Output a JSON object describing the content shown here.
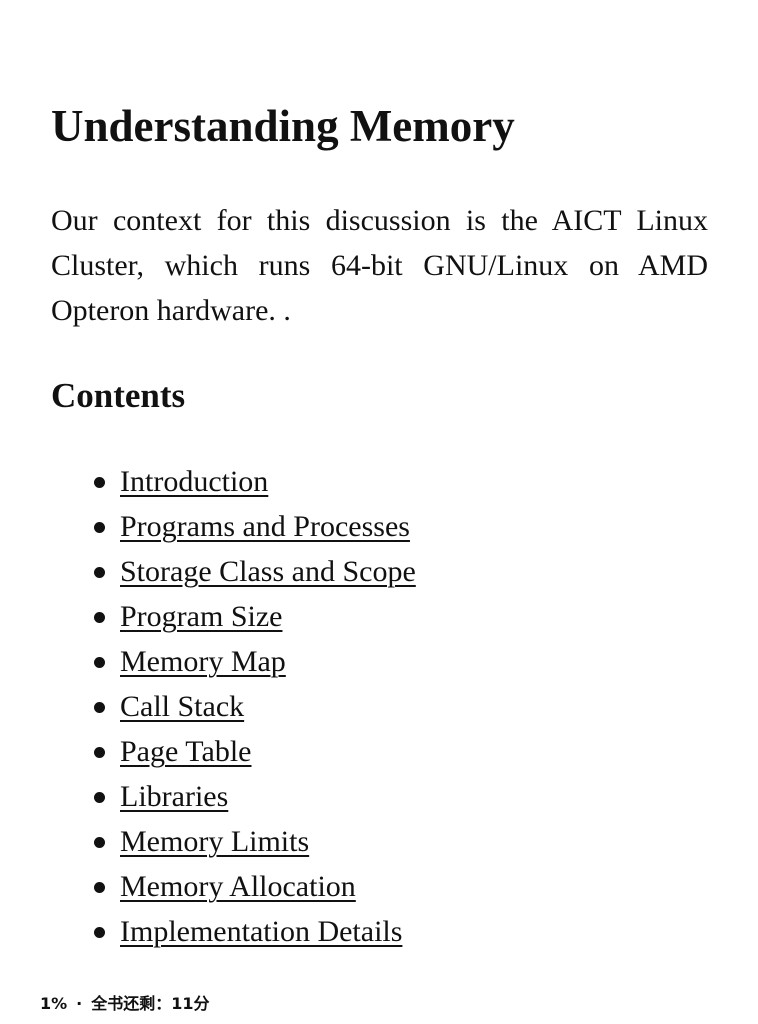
{
  "article": {
    "title": "Understanding Memory",
    "intro": "Our context for this discussion is the AICT Linux Cluster, which runs 64-bit GNU/Linux on AMD Opteron hardware. .",
    "contents_heading": "Contents"
  },
  "toc": {
    "items": [
      {
        "label": "Introduction"
      },
      {
        "label": "Programs and Processes"
      },
      {
        "label": "Storage Class and Scope"
      },
      {
        "label": "Program Size"
      },
      {
        "label": "Memory Map"
      },
      {
        "label": "Call Stack"
      },
      {
        "label": "Page Table"
      },
      {
        "label": "Libraries"
      },
      {
        "label": "Memory Limits"
      },
      {
        "label": "Memory Allocation"
      },
      {
        "label": "Implementation Details"
      }
    ]
  },
  "status": {
    "progress": "1%",
    "separator": "·",
    "remaining": "全书还剩：11分"
  }
}
